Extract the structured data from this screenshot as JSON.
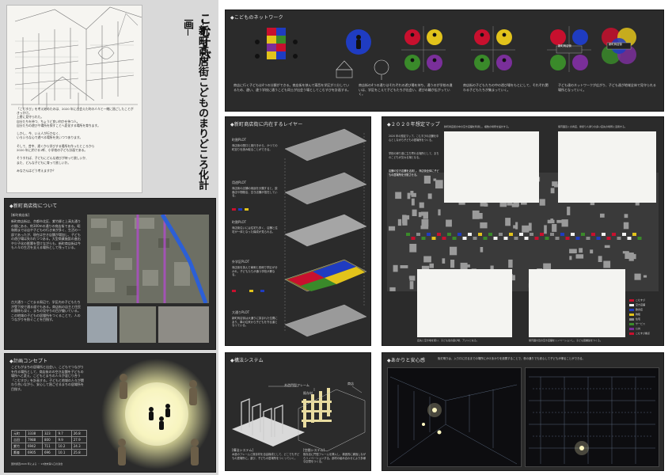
{
  "title": {
    "main": "こむすび",
    "sub": "─新町商店街こどものまりどころ化計画─"
  },
  "intro": {
    "lines": [
      "「こむすび」を考え始めたのは、2020 年に出会えた町の人々と一緒に過ごしたことがきっかけ。",
      "上層に見守られた。",
      "",
      "自分たちを待つ、ちょうど良い何かを待つ人。",
      "自分たちの遊びや場所を探すことへ変化する場所を育ちます。",
      "",
      "しかし、今、いえ人が行かなく、",
      "いろいろな心で遊べる場所を失いつつあります。",
      "",
      "そして、昔中、遠くから学びする場所を作ったところから",
      "2020 年に於ける1軒、小学校の子ども計画である。",
      "",
      "そうすれば、子どもにどんな遊びが待って欲しいか、",
      "また、どんな子どもに育って欲しいか。",
      "",
      "みなさんはどう考えますか？"
    ]
  },
  "sections": {
    "shinmachi": "◆新町商店街について",
    "concept": "◆計画コンセプト",
    "network": "◆こどものネットワーク",
    "layers": "◆新町商店街に内在するレイヤー",
    "map2020": "◆２０２０年想定マップ",
    "structure": "◆構法システム",
    "light": "◆あかりと安心感"
  },
  "shinmachi_text": {
    "tag": "[新町商店街]",
    "body": "新町商店街は、京都市北区、紫竹柳と上高丸通りの間にある、約300mの通りの商店街である。昭和期までは店や子どもの行き来が多く、生活の一部であったが、現在は空き店舗が増加し、子どもの遊び場は失われつつある。大型商業施設の進出や少子化の影響を受けながらも、新町商店街は今も人々の生活を支える場所として残っている。",
    "body2": "古大通り・ごてまる周辺で、学区内の子どもたちが登下校で通る道でもある。商店街の店主と住民の関係も深く、まちの見守りの目が働いている。この地域の子どもの居場所をつくることで、人のつながりを紡ぐことを目指す。"
  },
  "concept": {
    "body": "こどもがまちの居場所と出会い、こどもでつながりを作る場所として、商店街のの空き店舗を子どもの場所へと変え、こどもとまちの人々が混じり合う「こむすび」を計画する。子どもと地域の人々が関わり合いながら、安心して過ごせるまちの居場所を目指す。",
    "table": [
      [
        "元町",
        "3338",
        "323",
        "9.7",
        "26.8"
      ],
      [
        "吉田",
        "7988",
        "800",
        "9.9",
        "27.9"
      ],
      [
        "紫竹",
        "6942",
        "711",
        "10.2",
        "24.3"
      ],
      [
        "鷹峯",
        "6905",
        "696",
        "10.1",
        "25.8"
      ]
    ],
    "table_note": "国勢調査2020 年による ・ 13歳未満人口の割合"
  },
  "network": {
    "captions": [
      "商店に行く子どもは4つの分類ができる。商店街を挟んで東西を学区が二分しているため、違い、違う学校に通うこども同士が出会う場としてこむすびを計画する。",
      "商店街の4つの通りはそれぞれの遊び場を持ち、通うのが学校の違いは、学区をこえて子どもたちが出会い、遊びの輪が広がっていく。",
      "商店街の子どもたちの中の遊び場をもとにして、それぞれ関わる子どもたちが集まっていく。",
      "子ども達のネットワークが広がり、子ども達が地域全体で見守られる場所となっていく。"
    ],
    "labels": [
      "新町商店街",
      "新町商店街"
    ]
  },
  "layers": {
    "items": [
      {
        "title": "町割PLOT",
        "text": "商店街の間口と奥行きから、かつての町割りを読み取ることができる。"
      },
      {
        "title": "用途PLOT",
        "text": "商店街の店舗の用途を分類すると、飲食店や物販店、空き店舗が混在している。"
      },
      {
        "title": "町割PLOT",
        "text": "商店街沿いには住宅も多く、店舗と住宅が一体となった構成が見られる。"
      },
      {
        "title": "外学区PLOT",
        "text": "商店街を挟んで東側と西側で学区が分かれ、子どもたちが通う学校が異なる。"
      },
      {
        "title": "大通りPLOT",
        "text": "新町商店街は大通りに挟まれた位置にあり、車の往来から子どもを守る道となっている。"
      }
    ]
  },
  "map2020": {
    "notes": [
      "新町商店街の中の空き店舗を利用し、複数の場所を設計する。",
      "保育園近くの商店、塾帰り人通りの多い店先の場所に活用する。",
      "2020 年の想定マップ。こむすびの店舗を中心としながら子どもの居場所をつくる。",
      "学校の帰り道に立ち寄れる場所として、まちのこどもが交わる場となる。",
      "店舗の空き店舗を活用し、商店街全体に子どもの居場所を分散させる。",
      "店先と空き地を使い、子ども達の遊び場、アジトとなる。",
      "保育園付近の空き店舗をリノベーションし、子ども図書館をつくる。",
      "子ども図書館のすぐ近くに、空地を活かした子どもの広場をつくる。"
    ],
    "legend": [
      "こむすび",
      "空き店舗",
      "飲食店",
      "物販",
      "住宅",
      "サービス",
      "公共",
      "こむすび拠点"
    ]
  },
  "structure": {
    "labels": [
      "木造門型フレーム",
      "既存材",
      "商店"
    ],
    "captions": [
      {
        "title": "[構法システム]",
        "text": "木造のフレームと既存材を自由構成として、どこでも子どもの居場所に。遊び、子どもの居場所をつくっていく。"
      },
      {
        "title": "[空間システム]",
        "text": "既存店に門型フレームを挿入し、構造的に補強しながらリノベーションする。部材の組み合わせにより多様な空間をつくる。"
      }
    ]
  },
  "light": {
    "caption": "街灯明りは、入り口に灯るまでの場所にかけあかりを設置することで、夜の通りでも安心して子どもが帰ることができる。"
  },
  "colors": {
    "panel": "#2b2b2b",
    "grey": "#d9d9d9",
    "red": "#c8102e",
    "blue": "#1f3cc1",
    "yellow": "#e2c31b",
    "green": "#3a8a2a",
    "purple": "#7a2f9a"
  }
}
